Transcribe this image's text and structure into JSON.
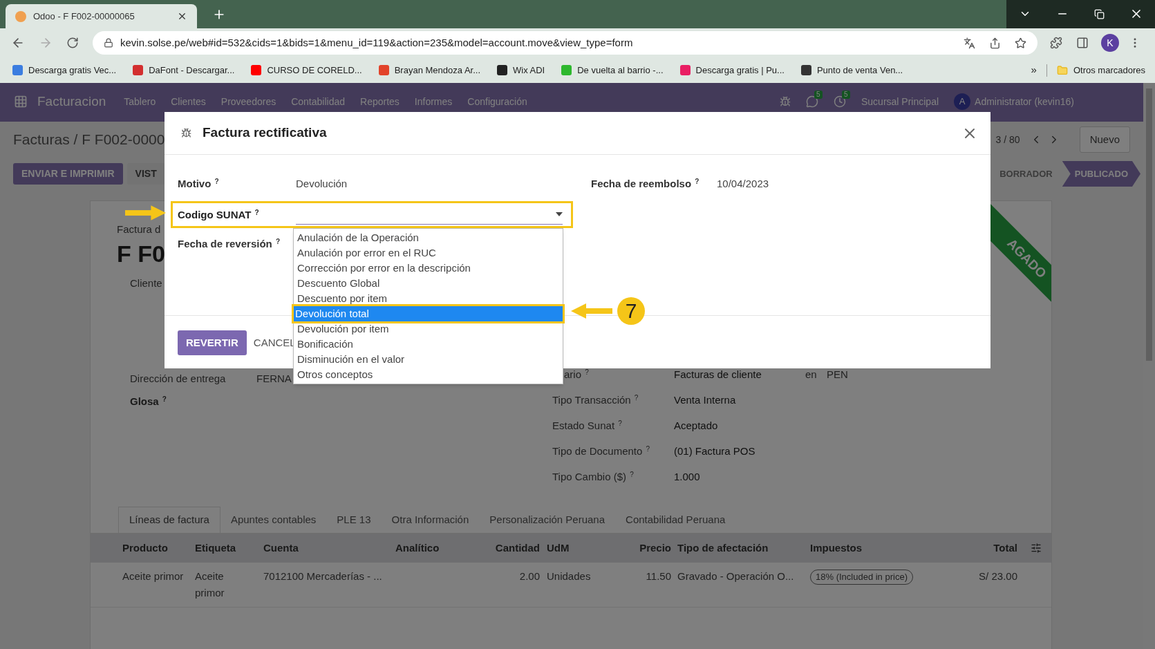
{
  "browser": {
    "tab_title": "Odoo - F F002-00000065",
    "url": "kevin.solse.pe/web#id=532&cids=1&bids=1&menu_id=119&action=235&model=account.move&view_type=form",
    "profile": "K",
    "bookmarks": [
      {
        "label": "Descarga gratis Vec...",
        "color": "#3b7de0"
      },
      {
        "label": "DaFont - Descargar...",
        "color": "#d32f2f"
      },
      {
        "label": "CURSO DE CORELD...",
        "color": "#ff0000"
      },
      {
        "label": "Brayan Mendoza Ar...",
        "color": "#e2432a"
      },
      {
        "label": "Wix ADI",
        "color": "#222222"
      },
      {
        "label": "De vuelta al barrio -...",
        "color": "#2eb82e"
      },
      {
        "label": "Descarga gratis | Pu...",
        "color": "#e91e63"
      },
      {
        "label": "Punto de venta Ven...",
        "color": "#333333"
      }
    ],
    "more": "»",
    "other_bookmarks": "Otros marcadores"
  },
  "navbar": {
    "app": "Facturacion",
    "menu": [
      "Tablero",
      "Clientes",
      "Proveedores",
      "Contabilidad",
      "Reportes",
      "Informes",
      "Configuración"
    ],
    "messages": "5",
    "activities": "5",
    "company": "Sucursal Principal",
    "avatar": "A",
    "user": "Administrator (kevin16)"
  },
  "control_panel": {
    "breadcrumb": "Facturas / F F002-0000",
    "pager": "3 / 80",
    "new_button": "Nuevo",
    "actions": [
      "ENVIAR E IMPRIMIR",
      "VIST"
    ],
    "statuses": [
      {
        "label": "BORRADOR",
        "selected": false
      },
      {
        "label": "PUBLICADO",
        "selected": true
      }
    ]
  },
  "sheet": {
    "ribbon": "AGADO",
    "subtitle": "Factura d",
    "number": "F F0",
    "customer_label": "Cliente",
    "left_fields": [
      {
        "label": "Dirección de entrega",
        "value": "FERNA"
      },
      {
        "label": "Glosa",
        "help": "?"
      }
    ],
    "right_fields": [
      {
        "label": "ario",
        "help": "?",
        "value": "Facturas de cliente",
        "extra_label": "en",
        "extra_value": "PEN"
      },
      {
        "label": "Tipo Transacción",
        "help": "?",
        "value": "Venta Interna"
      },
      {
        "label": "Estado Sunat",
        "help": "?",
        "value": "Aceptado"
      },
      {
        "label": "Tipo de Documento",
        "help": "?",
        "value": "(01) Factura POS"
      },
      {
        "label": "Tipo Cambio ($)",
        "help": "?",
        "value": "1.000"
      }
    ],
    "tabs": [
      {
        "label": "Líneas de factura",
        "selected": true
      },
      {
        "label": "Apuntes contables",
        "selected": false
      },
      {
        "label": "PLE 13",
        "selected": false
      },
      {
        "label": "Otra Información",
        "selected": false
      },
      {
        "label": "Personalización Peruana",
        "selected": false
      },
      {
        "label": "Contabilidad Peruana",
        "selected": false
      }
    ],
    "table": {
      "columns": [
        "Producto",
        "Etiqueta",
        "Cuenta",
        "Analítico",
        "Cantidad",
        "UdM",
        "Precio",
        "Tipo de afectación",
        "Impuestos",
        "Total"
      ],
      "rows": [
        {
          "product": "Aceite primor",
          "label": "Aceite primor",
          "account": "7012100 Mercaderías - ...",
          "quantity": "2.00",
          "uom": "Unidades",
          "price": "11.50",
          "affectation": "Gravado - Operación O...",
          "taxes": [
            "18% (Included in price)"
          ],
          "total": "S/ 23.00"
        }
      ]
    }
  },
  "dialog": {
    "title": "Factura rectificativa",
    "motivo": {
      "label": "Motivo",
      "help": "?",
      "value": "Devolución"
    },
    "refund_date": {
      "label": "Fecha de reembolso",
      "help": "?",
      "value": "10/04/2023"
    },
    "sunat_code": {
      "label": "Codigo SUNAT",
      "help": "?",
      "expanded": true,
      "options": [
        {
          "label": "Anulación de la Operación",
          "selected": false
        },
        {
          "label": "Anulación por error en el RUC",
          "selected": false
        },
        {
          "label": "Corrección por error en la descripción",
          "selected": false
        },
        {
          "label": "Descuento Global",
          "selected": false
        },
        {
          "label": "Descuento por item",
          "selected": false
        },
        {
          "label": "Devolución total",
          "selected": true
        },
        {
          "label": "Devolución por item",
          "selected": false
        },
        {
          "label": "Bonificación",
          "selected": false
        },
        {
          "label": "Disminución en el valor",
          "selected": false
        },
        {
          "label": "Otros conceptos",
          "selected": false
        }
      ]
    },
    "reversal_date": {
      "label": "Fecha de reversión",
      "help": "?"
    },
    "buttons": [
      {
        "label": "REVERTIR",
        "kind": "primary"
      },
      {
        "label": "CANCEL",
        "kind": "secondary"
      }
    ]
  },
  "annotation": {
    "step": "7"
  }
}
